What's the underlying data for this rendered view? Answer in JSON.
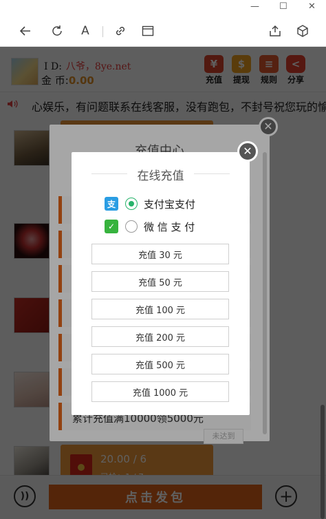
{
  "window": {
    "minimize": "—",
    "maximize": "☐",
    "close": "✕"
  },
  "toolbar": {
    "back_icon": "arrow-left-icon",
    "reload_icon": "reload-icon",
    "reader_label": "A",
    "link_icon": "link-icon",
    "window_icon": "window-icon",
    "share_icon": "share-icon",
    "cube_icon": "cube-icon"
  },
  "user": {
    "id_label": "I D:",
    "id_value": "八爷，8ye.net",
    "coins_label": "金 币:",
    "coins_value": "0.00"
  },
  "top_buttons": [
    {
      "label": "充值",
      "color": "#d9442b",
      "glyph": "¥"
    },
    {
      "label": "提现",
      "color": "#f0a020",
      "glyph": "$"
    },
    {
      "label": "规则",
      "color": "#e25830",
      "glyph": "≡"
    },
    {
      "label": "分享",
      "color": "#e54030",
      "glyph": "<"
    }
  ],
  "marquee": {
    "text": "心娱乐，有问题联系在线客服，没有跑包，不封号祝您玩的愉快"
  },
  "chat": {
    "bubble_amount": "20.00 / 6",
    "bubble_sub": "已抢：1 / 7"
  },
  "bottom": {
    "voice_glyph": "))",
    "send_label": "点击发包",
    "plus_glyph": "+"
  },
  "recharge_center": {
    "title": "充值中心",
    "last_item": "累计充值满10000领5000元",
    "not_reached": "未达到",
    "close": "✕"
  },
  "online_recharge": {
    "title": "在线充值",
    "close": "✕",
    "methods": [
      {
        "label": "支付宝支付",
        "selected": true,
        "color": "#2a9de3",
        "glyph": "支"
      },
      {
        "label": "微 信 支 付",
        "selected": false,
        "color": "#37b33e",
        "glyph": "✓"
      }
    ],
    "amounts": [
      "充值 30 元",
      "充值 50 元",
      "充值 100 元",
      "充值 200 元",
      "充值 500 元",
      "充值 1000 元"
    ]
  }
}
